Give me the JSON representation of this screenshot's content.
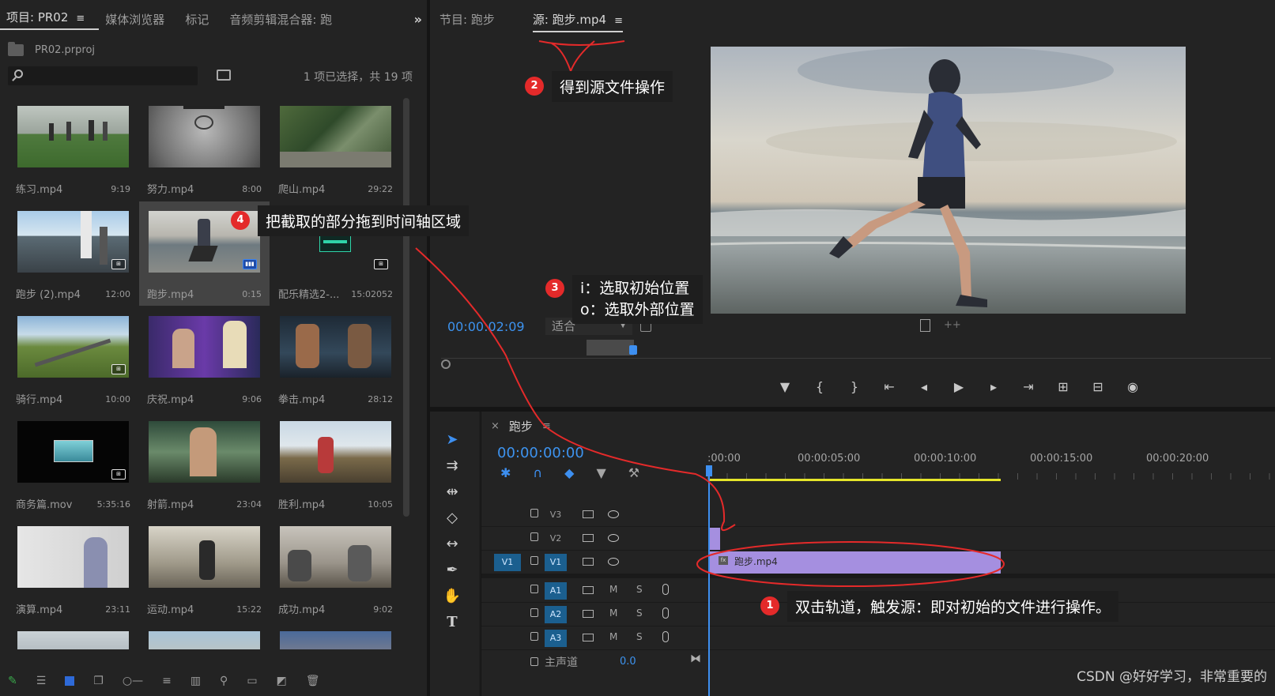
{
  "colors": {
    "accent_blue": "#3d93ef",
    "clip_purple": "#a58fe0",
    "workarea_yellow": "#e5e52a",
    "annotation_red": "#e42a2a"
  },
  "project_panel": {
    "tabs": [
      {
        "label": "项目: PR02",
        "menu": "≡"
      },
      {
        "label": "媒体浏览器"
      },
      {
        "label": "标记"
      },
      {
        "label": "音频剪辑混合器: 跑"
      }
    ],
    "overflow": "»",
    "project_file": "PR02.prproj",
    "search_placeholder": "",
    "selection_count": "1 项已选择，共 19 项",
    "items": [
      {
        "name": "练习.mp4",
        "duration": "9:19",
        "icon": "none"
      },
      {
        "name": "努力.mp4",
        "duration": "8:00",
        "icon": "none"
      },
      {
        "name": "爬山.mp4",
        "duration": "29:22",
        "icon": "none"
      },
      {
        "name": "跑步 (2).mp4",
        "duration": "12:00",
        "icon": "film-badge"
      },
      {
        "name": "跑步.mp4",
        "duration": "0:15",
        "icon": "film-badge-blue",
        "selected": true
      },
      {
        "name": "配乐精选2-...",
        "duration": "15:02052",
        "icon": "film-badge"
      },
      {
        "name": "骑行.mp4",
        "duration": "10:00",
        "icon": "film-badge"
      },
      {
        "name": "庆祝.mp4",
        "duration": "9:06",
        "icon": "none"
      },
      {
        "name": "拳击.mp4",
        "duration": "28:12",
        "icon": "none"
      },
      {
        "name": "商务篇.mov",
        "duration": "5:35:16",
        "icon": "film-badge"
      },
      {
        "name": "射箭.mp4",
        "duration": "23:04",
        "icon": "none"
      },
      {
        "name": "胜利.mp4",
        "duration": "10:05",
        "icon": "none"
      },
      {
        "name": "演算.mp4",
        "duration": "23:11",
        "icon": "none"
      },
      {
        "name": "运动.mp4",
        "duration": "15:22",
        "icon": "none"
      },
      {
        "name": "成功.mp4",
        "duration": "9:02",
        "icon": "none"
      }
    ]
  },
  "source_monitor": {
    "tabs": [
      {
        "label": "节目: 跑步"
      },
      {
        "label": "源: 跑步.mp4",
        "menu": "≡"
      }
    ],
    "timecode": "00:00:02:09",
    "fit_label": "适合",
    "transport_icons": [
      "marker-icon",
      "mark-in-icon",
      "mark-out-icon",
      "go-to-in-icon",
      "step-back-icon",
      "play-icon",
      "step-forward-icon",
      "go-to-out-icon",
      "insert-icon",
      "overwrite-icon",
      "camera-icon"
    ]
  },
  "timeline": {
    "sequence_name": "跑步",
    "close": "×",
    "menu": "≡",
    "timecode": "00:00:00:00",
    "ruler_labels": [
      ":00:00",
      "00:00:05:00",
      "00:00:10:00",
      "00:00:15:00",
      "00:00:20:00"
    ],
    "tracks": [
      {
        "name": "V3"
      },
      {
        "name": "V2"
      },
      {
        "name": "V1",
        "source_patch": "V1"
      },
      {
        "name": "A1",
        "m": "M",
        "s": "S"
      },
      {
        "name": "A2",
        "m": "M",
        "s": "S"
      },
      {
        "name": "A3",
        "m": "M",
        "s": "S"
      }
    ],
    "clip_name": "跑步.mp4",
    "master_label": "主声道",
    "master_value": "0.0"
  },
  "annotations": {
    "a1": {
      "num": "1",
      "text": "双击轨道，触发源：即对初始的文件进行操作。"
    },
    "a2": {
      "num": "2",
      "text": "得到源文件操作"
    },
    "a3": {
      "num": "3",
      "line1": "i：选取初始位置",
      "line2": "o：选取外部位置"
    },
    "a4": {
      "num": "4",
      "text": "把截取的部分拖到时间轴区域"
    }
  },
  "watermark": "CSDN @好好学习，非常重要的"
}
